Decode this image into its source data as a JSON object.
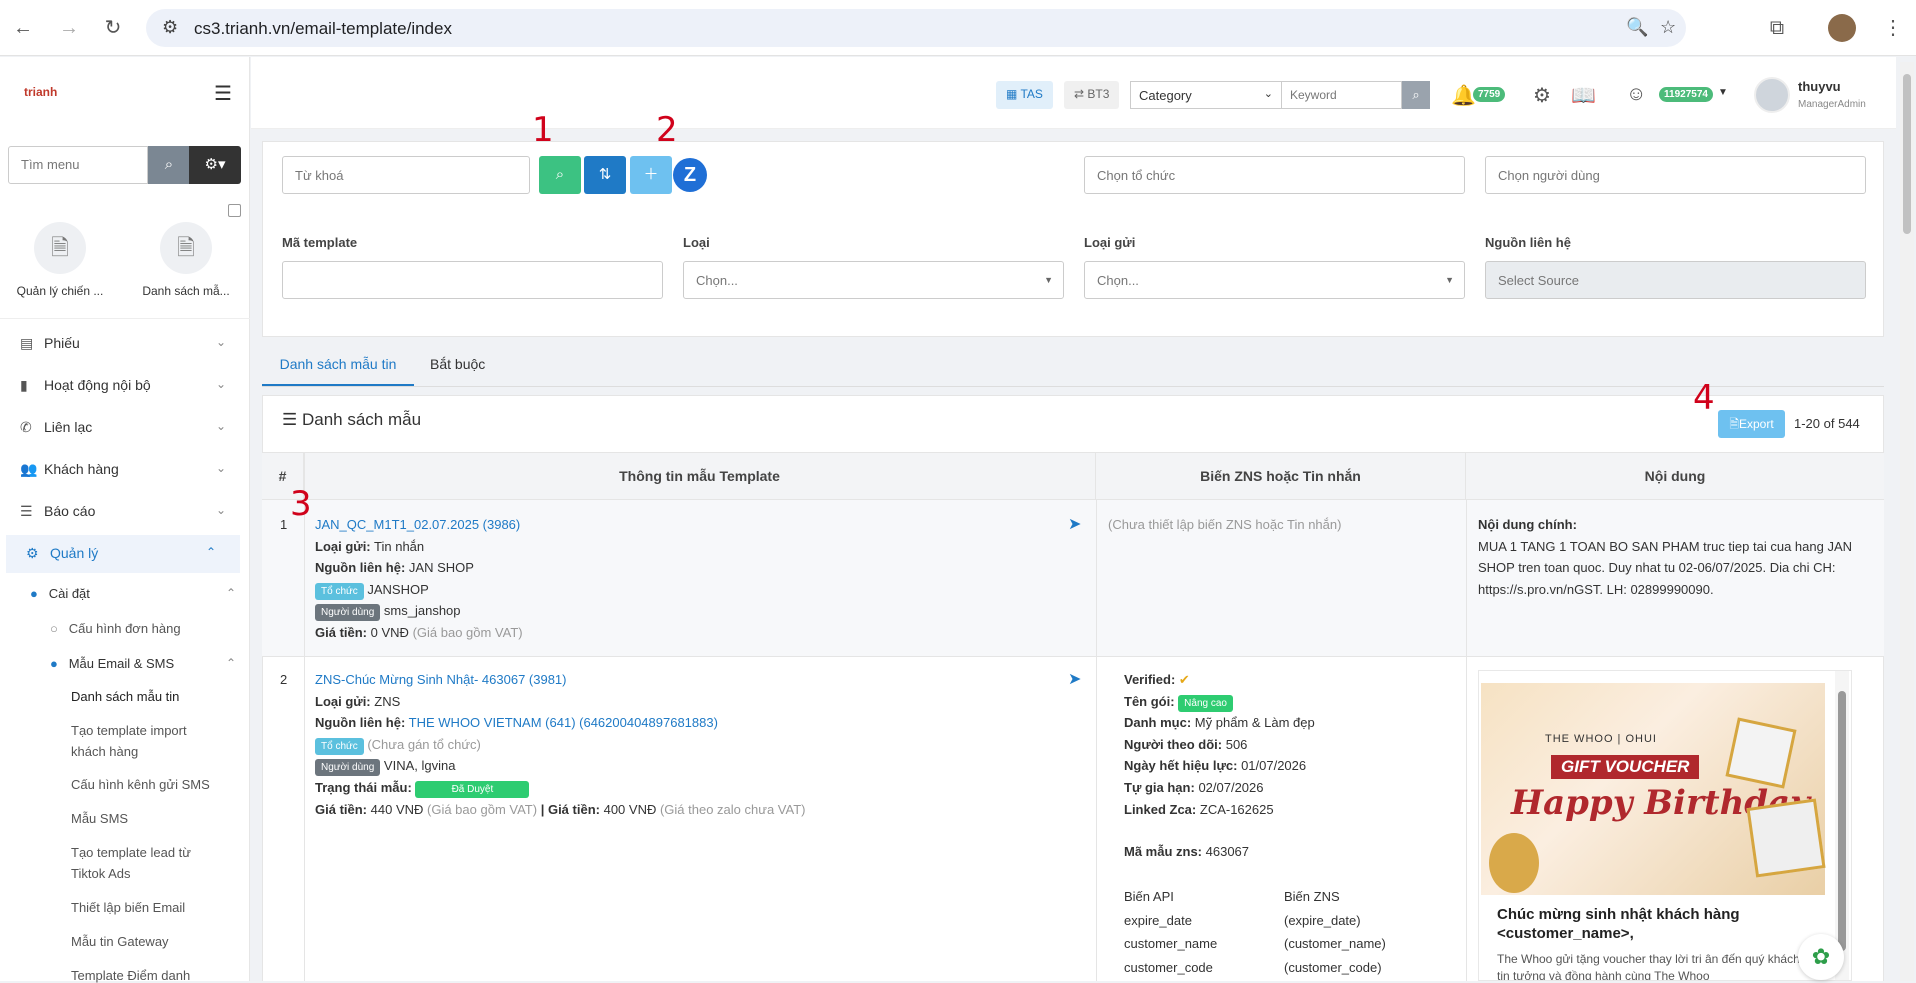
{
  "browser": {
    "url": "cs3.trianh.vn/email-template/index"
  },
  "sidebar": {
    "logo": "trianh",
    "search_placeholder": "Tìm menu",
    "quick": [
      {
        "label": "Quản lý chiến ..."
      },
      {
        "label": "Danh sách mẫ..."
      }
    ],
    "items": [
      {
        "label": "Phiếu"
      },
      {
        "label": "Hoạt động nội bộ"
      },
      {
        "label": "Liên lạc"
      },
      {
        "label": "Khách hàng"
      },
      {
        "label": "Báo cáo"
      },
      {
        "label": "Quản lý"
      }
    ],
    "sub": {
      "caidat": "Cài đặt",
      "cauhinh": "Cấu hình đơn hàng",
      "mauemail": "Mẫu Email & SMS",
      "leaf": [
        "Danh sách mẫu tin",
        "Tạo template import",
        "khách hàng",
        "Cấu hình kênh gửi SMS",
        "Mẫu SMS",
        "Tạo template lead từ",
        "Tiktok Ads",
        "Thiết lập biến Email",
        "Mẫu tin Gateway",
        "Template Điểm danh"
      ]
    }
  },
  "topbar": {
    "tas": "TAS",
    "bt3": "BT3",
    "category": "Category",
    "keyword": "Keyword",
    "notif_count": "7759",
    "points": "11927574",
    "username": "thuyvu",
    "role": "ManagerAdmin"
  },
  "filters": {
    "keyword_placeholder": "Từ khoá",
    "org_placeholder": "Chọn tổ chức",
    "user_placeholder": "Chọn người dùng",
    "ma_template": "Mã template",
    "loai": "Loại",
    "loai_gui": "Loại gửi",
    "nguon": "Nguồn liên hệ",
    "chon": "Chọn...",
    "select_source": "Select Source"
  },
  "annotations": {
    "n1": "1",
    "n2": "2",
    "n3": "3",
    "n4": "4"
  },
  "tabs": [
    "Danh sách mẫu tin",
    "Bắt buộc"
  ],
  "list": {
    "title": "Danh sách mẫu",
    "export": "Export",
    "range": "1-20 of 544"
  },
  "table": {
    "headers": [
      "#",
      "Thông tin mẫu Template",
      "Biến ZNS hoặc Tin nhắn",
      "Nội dung"
    ],
    "rows": [
      {
        "num": "1",
        "title": "JAN_QC_M1T1_02.07.2025 (3986)",
        "loai_gui_label": "Loại gửi:",
        "loai_gui": "Tin nhắn",
        "nguon_label": "Nguồn liên hệ:",
        "nguon": "JAN SHOP",
        "org_tag": "Tổ chức",
        "org": "JANSHOP",
        "user_tag": "Người dùng",
        "user": "sms_janshop",
        "price_label": "Giá tiền:",
        "price": "0 VNĐ",
        "price_note": "(Giá bao gồm VAT)",
        "zns": "(Chưa thiết lập biến ZNS hoặc Tin nhắn)",
        "content_label": "Nội dung chính:",
        "content": "MUA 1 TANG 1 TOAN BO SAN PHAM truc tiep tai cua hang JAN SHOP tren toan quoc. Duy nhat tu 02-06/07/2025. Dia chi CH: https://s.pro.vn/nGST. LH: 02899990090."
      },
      {
        "num": "2",
        "title": "ZNS-Chúc Mừng Sinh Nhật- 463067 (3981)",
        "loai_gui_label": "Loại gửi:",
        "loai_gui": "ZNS",
        "nguon_label": "Nguồn liên hệ:",
        "nguon": "THE WHOO VIETNAM (641) (646200404897681883)",
        "org_tag": "Tổ chức",
        "org": "(Chưa gán tổ chức)",
        "user_tag": "Người dùng",
        "user": "VINA, lgvina",
        "status_label": "Trạng thái mẫu:",
        "status": "Đã Duyệt",
        "price_label": "Giá tiền:",
        "price": "440 VNĐ",
        "price_note": "(Giá bao gồm VAT)",
        "price2_label": "| Giá tiền:",
        "price2": "400 VNĐ",
        "price2_note": "(Giá theo zalo chưa VAT)",
        "zns_info": [
          {
            "k": "Verified:",
            "v": ""
          },
          {
            "k": "Tên gói:",
            "v": "Nâng cao"
          },
          {
            "k": "Danh mục:",
            "v": "Mỹ phẩm & Làm đẹp"
          },
          {
            "k": "Người theo dõi:",
            "v": "506"
          },
          {
            "k": "Ngày hết hiệu lực:",
            "v": "01/07/2026"
          },
          {
            "k": "Tự gia hạn:",
            "v": "02/07/2026"
          },
          {
            "k": "Linked Zca:",
            "v": "ZCA-162625"
          }
        ],
        "ma_mau_label": "Mã mẫu zns:",
        "ma_mau": "463067",
        "bien_api": "Biến API",
        "bien_zns": "Biến ZNS",
        "vars": [
          {
            "api": "expire_date",
            "zns": "(expire_date)"
          },
          {
            "api": "customer_name",
            "zns": "(customer_name)"
          },
          {
            "api": "customer_code",
            "zns": "(customer_code)"
          }
        ],
        "voucher": {
          "brand": "THE WHOO | OHUI",
          "gift": "GIFT VOUCHER",
          "happy": "Happy Birthday",
          "heading": "Chúc mừng sinh nhật khách hàng <customer_name>,",
          "body": "The Whoo gửi tặng voucher thay lời tri ân đến quý khách đã tin tưởng và đồng hành cùng The Whoo"
        }
      }
    ]
  }
}
